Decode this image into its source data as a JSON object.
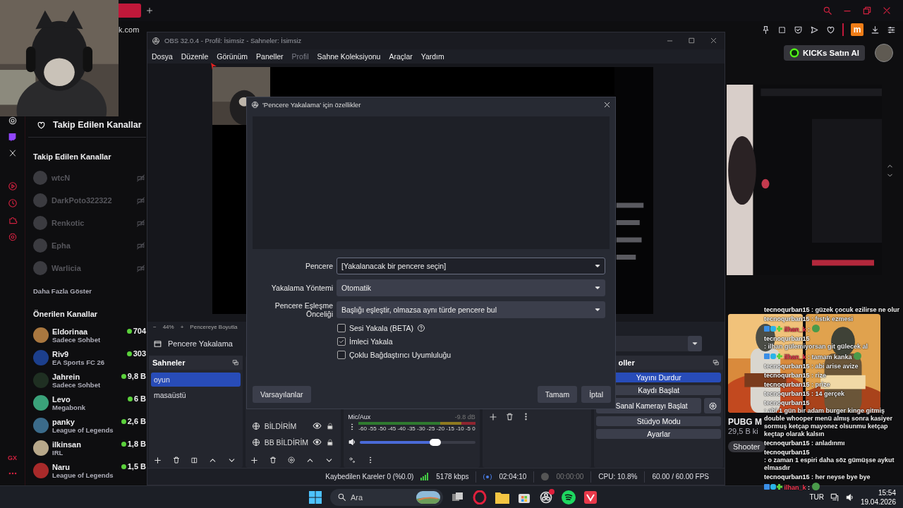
{
  "browser": {
    "address": "k.com",
    "extension_badge": "m",
    "rail_label": "GX",
    "kicks_button": "KICKs Satın Al"
  },
  "sidebar": {
    "heading": "Takip Edilen Kanallar",
    "followed_title": "Takip Edilen Kanallar",
    "followed": [
      {
        "name": "wtcN"
      },
      {
        "name": "DarkPoto322322"
      },
      {
        "name": "Renkotic"
      },
      {
        "name": "Epha"
      },
      {
        "name": "Warlicia"
      }
    ],
    "show_more": "Daha Fazla Göster",
    "recommended_title": "Önerilen Kanallar",
    "recommended": [
      {
        "name": "Eldorinaa",
        "category": "Sadece Sohbet",
        "viewers": "704"
      },
      {
        "name": "Riv9",
        "category": "EA Sports FC 26",
        "viewers": "303"
      },
      {
        "name": "Jahrein",
        "category": "Sadece Sohbet",
        "viewers": "9,8 B"
      },
      {
        "name": "Levo",
        "category": "Megabonk",
        "viewers": "6 B"
      },
      {
        "name": "panky",
        "category": "League of Legends",
        "viewers": "2,6 B"
      },
      {
        "name": "ilkinsan",
        "category": "IRL",
        "viewers": "1,8 B"
      },
      {
        "name": "Naru",
        "category": "League of Legends",
        "viewers": "1,5 B"
      }
    ]
  },
  "cards": [
    {
      "kind": "picture",
      "title": "PUBG M",
      "viewers": "29,5 B ki",
      "tags": [
        "Shooter"
      ]
    },
    {
      "kind": "picture"
    }
  ],
  "obs": {
    "title": "OBS 32.0.4 - Profil: İsimsiz - Sahneler: İsimsiz",
    "menu": [
      {
        "label": "Dosya",
        "disabled": false
      },
      {
        "label": "Düzenle",
        "disabled": false
      },
      {
        "label": "Görünüm",
        "disabled": false
      },
      {
        "label": "Paneller",
        "disabled": false
      },
      {
        "label": "Profil",
        "disabled": true
      },
      {
        "label": "Sahne Koleksiyonu",
        "disabled": false
      },
      {
        "label": "Araçlar",
        "disabled": false
      },
      {
        "label": "Yardım",
        "disabled": false
      }
    ],
    "zoom": {
      "minus": "−",
      "value": "44%",
      "plus": "+",
      "fit": "Pencereye Boyutla"
    },
    "source_bar": "Pencere Yakalama",
    "scenes_title": "Sahneler",
    "scenes": [
      {
        "name": "oyun",
        "selected": true
      },
      {
        "name": "masaüstü",
        "selected": false
      }
    ],
    "sources": [
      {
        "name": "BİLDİRİM",
        "visible": true,
        "locked": true
      },
      {
        "name": "BB BİLDİRİM",
        "visible": true,
        "locked": true
      }
    ],
    "mixer": {
      "name": "Mic/Aux",
      "reading": "-9.8 dB",
      "ticks": [
        "-60",
        "-55",
        "-50",
        "-45",
        "-40",
        "-35",
        "-30",
        "-25",
        "-20",
        "-15",
        "-10",
        "-5",
        "0"
      ],
      "level": 0.65
    },
    "controls_title": "oller",
    "controls": [
      {
        "label": "Yayını Durdur",
        "active": true
      },
      {
        "label": "Kaydı Başlat",
        "active": false
      },
      {
        "label": "Sanal Kamerayı Başlat",
        "active": false
      },
      {
        "label": "Stüdyo Modu",
        "active": false
      },
      {
        "label": "Ayarlar",
        "active": false
      }
    ],
    "status": {
      "dropped": "Kaybedilen Kareler 0 (%0.0)",
      "bitrate": "5178 kbps",
      "live_time": "02:04:10",
      "rec_time": "00:00:00",
      "cpu": "CPU: 10.8%",
      "fps": "60.00 / 60.00 FPS"
    }
  },
  "dialog": {
    "title": "'Pencere Yakalama' için özellikler",
    "fields": [
      {
        "label": "Pencere",
        "value": "[Yakalanacak bir pencere seçin]",
        "focused": true
      },
      {
        "label": "Yakalama Yöntemi",
        "value": "Otomatik",
        "focused": false
      },
      {
        "label": "Pencere Eşleşme Önceliği",
        "value": "Başlığı eşleştir, olmazsa aynı türde pencere bul",
        "focused": false
      }
    ],
    "checks": [
      {
        "label": "Sesi Yakala (BETA)",
        "checked": false,
        "help": true
      },
      {
        "label": "İmleci Yakala",
        "checked": true,
        "help": false
      },
      {
        "label": "Çoklu Bağdaştırıcı Uyumluluğu",
        "checked": false,
        "help": false
      }
    ],
    "defaults_button": "Varsayılanlar",
    "ok_button": "Tamam",
    "cancel_button": "İptal"
  },
  "chat": [
    {
      "user": "tecnoqurban15",
      "text": ": güzek çocuk ezilirse ne olur",
      "badges": false
    },
    {
      "user": "tecnoqurban15",
      "text": ": fıstık ezmesi",
      "badges": false
    },
    {
      "user": "ilhan_k",
      "text": ":",
      "badges": true
    },
    {
      "user": "tecnoqurban15",
      "text": ": ilhan gülemiyorsan git gülecek al",
      "badges": false
    },
    {
      "user": "ilhan_k",
      "text": ": tamam kanka",
      "badges": true
    },
    {
      "user": "tecnoqurban15",
      "text": ": abi arise avize",
      "badges": false
    },
    {
      "user": "tecnoqurban15",
      "text": ": rize",
      "badges": false
    },
    {
      "user": "tecnoqurban15",
      "text": ": prize",
      "badges": false
    },
    {
      "user": "tecnoqurban15",
      "text": ": 14 gerçek",
      "badges": false
    },
    {
      "user": "tecnoqurban15",
      "text": ": abi 1 gün bir adam burger kinge gitmiş double whooper menü almış sonra kasiyer sormuş ketçap mayonez olsunmu ketçap keçtap olarak kalsın",
      "badges": false
    },
    {
      "user": "tecnoqurban15",
      "text": ": anladınmı",
      "badges": false
    },
    {
      "user": "tecnoqurban15",
      "text": ": o zaman 1 espiri daha söz gümüşse aykut elmasdır",
      "badges": false
    },
    {
      "user": "tecnoqurban15",
      "text": ": her neyse bye bye",
      "badges": false
    },
    {
      "user": "ilhan_k",
      "text": ":",
      "badges": true
    }
  ],
  "taskbar": {
    "search": "Ara",
    "language": "TUR",
    "time": "15:54",
    "date": "19.04.2026"
  }
}
